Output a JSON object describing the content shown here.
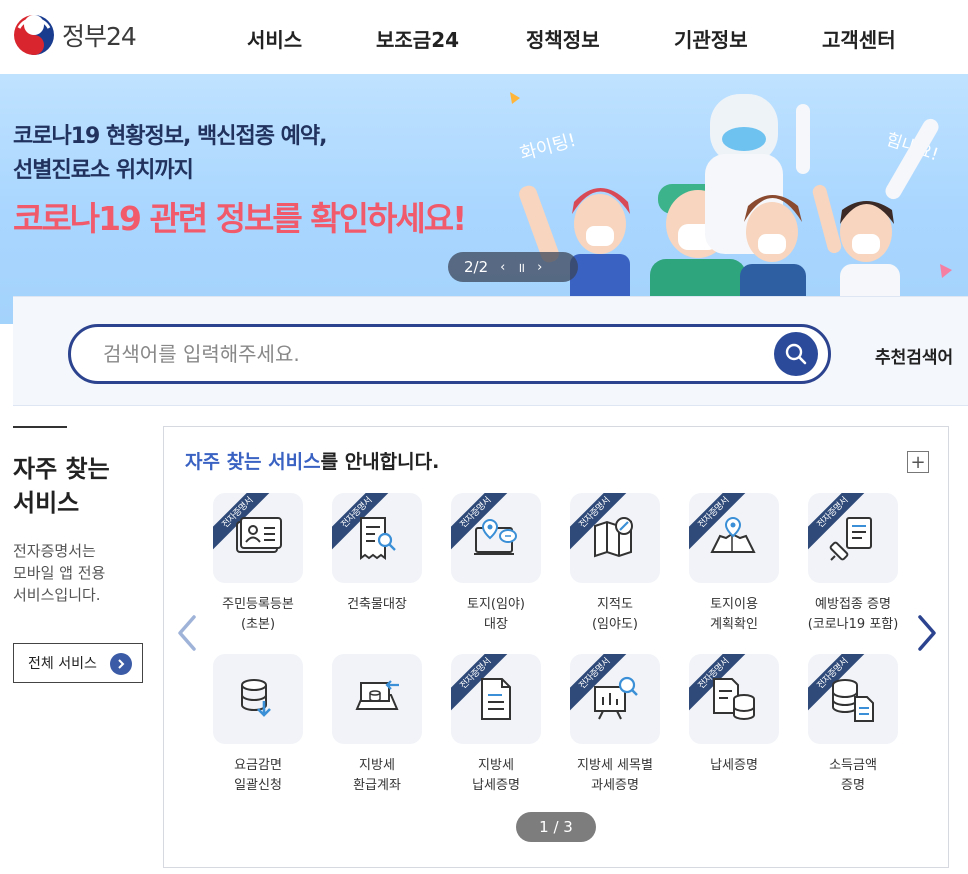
{
  "header": {
    "logo_text": "정부24",
    "nav": [
      "서비스",
      "보조금24",
      "정책정보",
      "기관정보",
      "고객센터"
    ]
  },
  "banner": {
    "line1": "코로나19 현황정보, 백신접종 예약,",
    "line2": "선별진료소 위치까지",
    "line3": "코로나19 관련 정보를 확인하세요!",
    "art_text_left": "화이팅!",
    "art_text_right": "힘내요!",
    "slide_counter": "2/2",
    "prev": "‹",
    "pause": "॥",
    "next": "›"
  },
  "search": {
    "placeholder": "검색어를 입력해주세요.",
    "recommended_label": "추천검색어"
  },
  "frequent": {
    "title_line1": "자주 찾는",
    "title_line2": "서비스",
    "desc_line1": "전자증명서는",
    "desc_line2": "모바일 앱 전용",
    "desc_line3": "서비스입니다.",
    "all_button": "전체 서비스",
    "panel_title_highlight": "자주 찾는 서비스",
    "panel_title_rest": "를 안내합니다.",
    "plus": "+",
    "ribbon_text": "전자증명서",
    "pager": "1 / 3",
    "services": [
      {
        "line1": "주민등록등본",
        "line2": "(초본)",
        "ribbon": true,
        "icon": "id-card-icon"
      },
      {
        "line1": "건축물대장",
        "line2": "",
        "ribbon": true,
        "icon": "building-register-icon"
      },
      {
        "line1": "토지(임야)",
        "line2": "대장",
        "ribbon": true,
        "icon": "land-register-icon"
      },
      {
        "line1": "지적도",
        "line2": "(임야도)",
        "ribbon": true,
        "icon": "cadastral-map-icon"
      },
      {
        "line1": "토지이용",
        "line2": "계획확인",
        "ribbon": true,
        "icon": "land-use-icon"
      },
      {
        "line1": "예방접종 증명",
        "line2": "(코로나19 포함)",
        "ribbon": true,
        "icon": "vaccine-icon"
      },
      {
        "line1": "요금감면",
        "line2": "일괄신청",
        "ribbon": false,
        "icon": "fee-reduction-icon"
      },
      {
        "line1": "지방세",
        "line2": "환급계좌",
        "ribbon": false,
        "icon": "tax-refund-icon"
      },
      {
        "line1": "지방세",
        "line2": "납세증명",
        "ribbon": true,
        "icon": "local-tax-cert-icon"
      },
      {
        "line1": "지방세 세목별",
        "line2": "과세증명",
        "ribbon": true,
        "icon": "tax-chart-icon"
      },
      {
        "line1": "납세증명",
        "line2": "",
        "ribbon": true,
        "icon": "tax-payment-cert-icon"
      },
      {
        "line1": "소득금액",
        "line2": "증명",
        "ribbon": true,
        "icon": "income-cert-icon"
      }
    ]
  },
  "colors": {
    "brand_navy": "#2c448f",
    "highlight_blue": "#3a62c3",
    "banner_pink": "#f15a6b",
    "ribbon_navy": "#2f4a79"
  }
}
